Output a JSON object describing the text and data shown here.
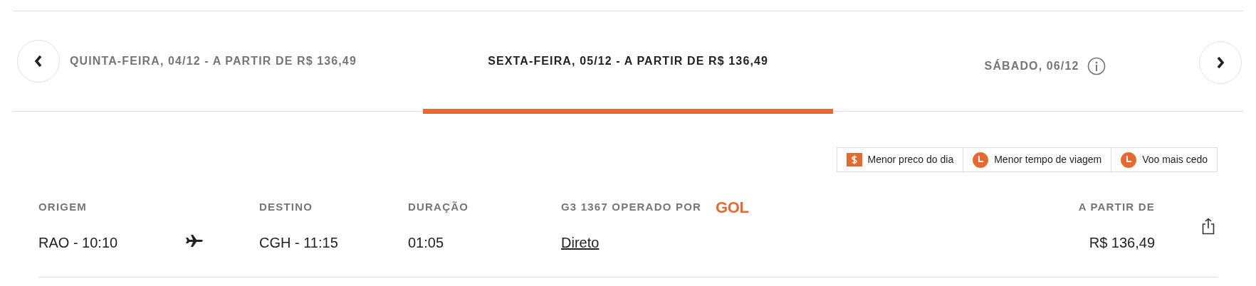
{
  "date_tabs": [
    {
      "label": "QUINTA-FEIRA, 04/12 - A PARTIR DE R$ 136,49",
      "selected": false,
      "info": false
    },
    {
      "label": "SEXTA-FEIRA, 05/12 - A PARTIR DE R$ 136,49",
      "selected": true,
      "info": false
    },
    {
      "label": "SÁBADO, 06/12",
      "selected": false,
      "info": true
    }
  ],
  "tags": [
    {
      "label": "Menor preco do dia",
      "kind": "price"
    },
    {
      "label": "Menor tempo de viagem",
      "kind": "clock"
    },
    {
      "label": "Voo mais cedo",
      "kind": "clock"
    }
  ],
  "flight": {
    "origin_label": "ORIGEM",
    "origin": "RAO - 10:10",
    "destination_label": "DESTINO",
    "destination": "CGH - 11:15",
    "duration_label": "DURAÇÃO",
    "duration": "01:05",
    "flight_label": "G3 1367 OPERADO POR",
    "airline_logo": "GOL",
    "stops": "Direto",
    "price_label": "A PARTIR DE",
    "price": "R$ 136,49"
  }
}
